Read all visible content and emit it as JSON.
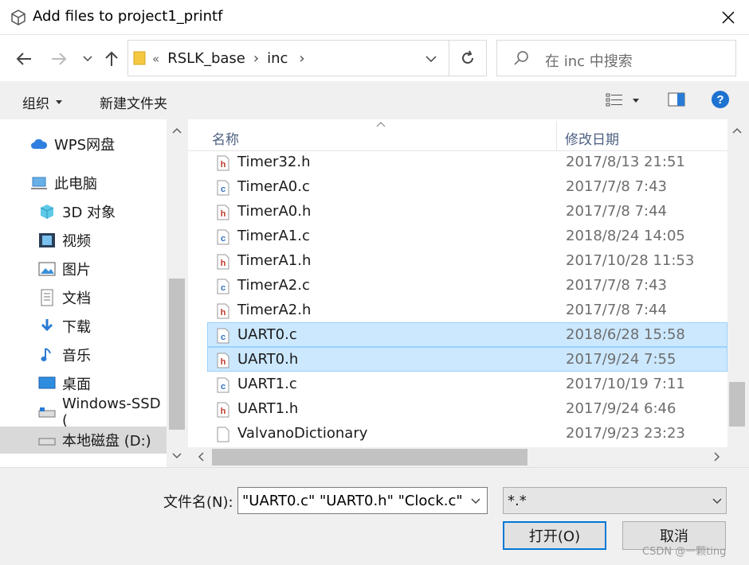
{
  "window": {
    "title": "Add files to project1_printf"
  },
  "address": {
    "overflow": "«",
    "crumbs": [
      "RSLK_base",
      "inc"
    ],
    "separator": "›"
  },
  "search": {
    "placeholder": "在 inc 中搜索"
  },
  "toolbar": {
    "organize": "组织",
    "new_folder": "新建文件夹"
  },
  "nav_tree": [
    {
      "label": "WPS网盘",
      "icon": "cloud-icon"
    },
    {
      "label": "此电脑",
      "icon": "computer-icon"
    },
    {
      "label": "3D 对象",
      "icon": "cube-icon"
    },
    {
      "label": "视频",
      "icon": "video-icon"
    },
    {
      "label": "图片",
      "icon": "picture-icon"
    },
    {
      "label": "文档",
      "icon": "document-icon"
    },
    {
      "label": "下载",
      "icon": "download-icon"
    },
    {
      "label": "音乐",
      "icon": "music-icon"
    },
    {
      "label": "桌面",
      "icon": "desktop-icon"
    },
    {
      "label": "Windows-SSD (",
      "icon": "drive-icon"
    },
    {
      "label": "本地磁盘 (D:)",
      "icon": "drive-icon"
    }
  ],
  "columns": {
    "name": "名称",
    "date": "修改日期"
  },
  "files": [
    {
      "name": "Timer32.h",
      "date": "2017/8/13 21:51",
      "type": "h",
      "selected": false
    },
    {
      "name": "TimerA0.c",
      "date": "2017/7/8 7:43",
      "type": "c",
      "selected": false
    },
    {
      "name": "TimerA0.h",
      "date": "2017/7/8 7:44",
      "type": "h",
      "selected": false
    },
    {
      "name": "TimerA1.c",
      "date": "2018/8/24 14:05",
      "type": "c",
      "selected": false
    },
    {
      "name": "TimerA1.h",
      "date": "2017/10/28 11:53",
      "type": "h",
      "selected": false
    },
    {
      "name": "TimerA2.c",
      "date": "2017/7/8 7:43",
      "type": "c",
      "selected": false
    },
    {
      "name": "TimerA2.h",
      "date": "2017/7/8 7:44",
      "type": "h",
      "selected": false
    },
    {
      "name": "UART0.c",
      "date": "2018/6/28 15:58",
      "type": "c",
      "selected": true
    },
    {
      "name": "UART0.h",
      "date": "2017/9/24 7:55",
      "type": "h",
      "selected": true
    },
    {
      "name": "UART1.c",
      "date": "2017/10/19 7:11",
      "type": "c",
      "selected": false
    },
    {
      "name": "UART1.h",
      "date": "2017/9/24 6:46",
      "type": "h",
      "selected": false
    },
    {
      "name": "ValvanoDictionary",
      "date": "2017/9/23 23:23",
      "type": "plain",
      "selected": false
    }
  ],
  "bottom": {
    "filename_label": "文件名(N):",
    "filename_value": "\"UART0.c\" \"UART0.h\" \"Clock.c\" \"(",
    "filetype_value": "*.*",
    "open_label": "打开(O)",
    "cancel_label": "取消"
  },
  "watermark": "CSDN @一颗ting",
  "colors": {
    "selection_bg": "#cce8ff",
    "selection_border": "#99d1ff",
    "accent": "#0078d7",
    "h_icon": "#c0392b",
    "c_icon": "#2e6fbf"
  }
}
